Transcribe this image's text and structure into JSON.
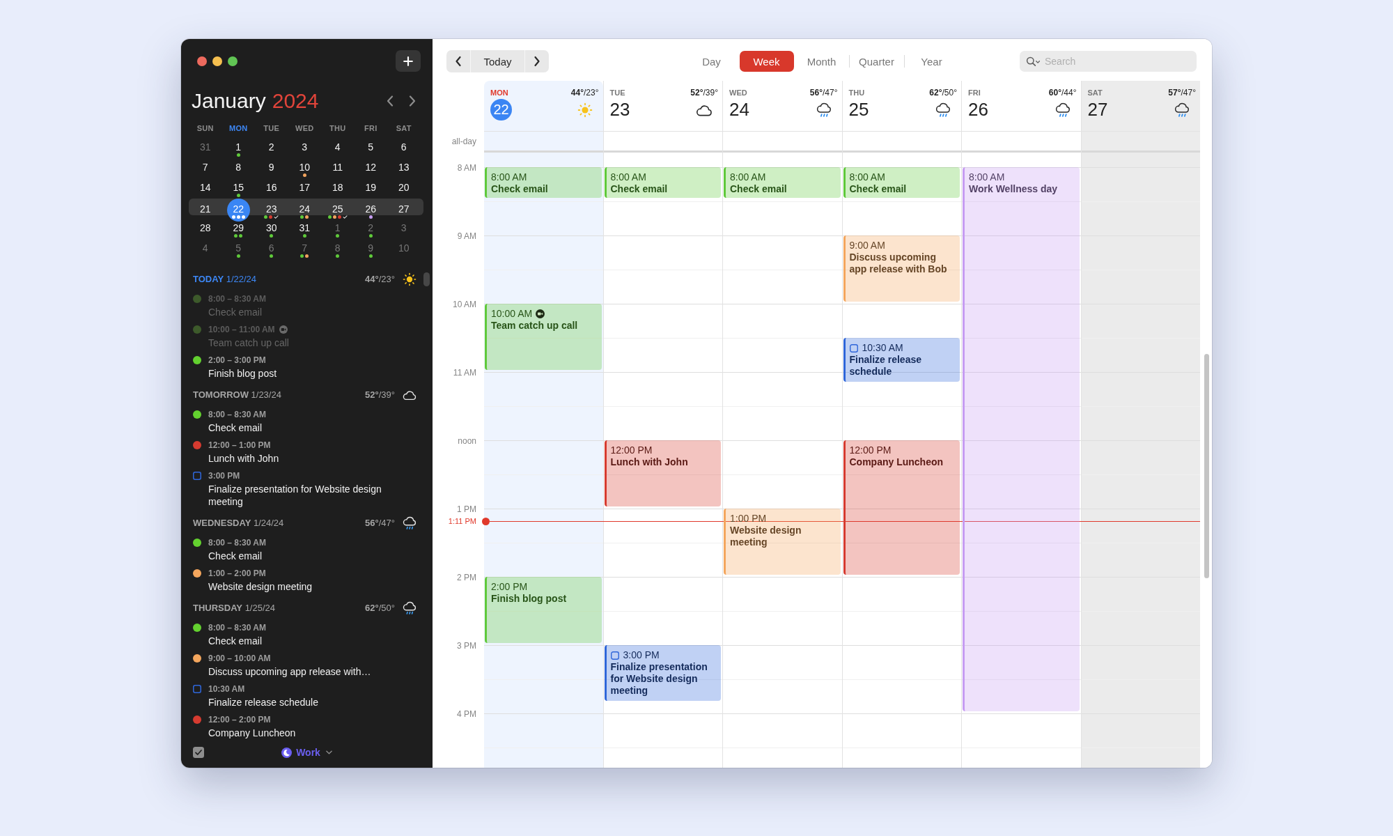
{
  "sidebar": {
    "month": "January",
    "year": "2024",
    "weekdays": [
      {
        "label": "SUN",
        "selected": false
      },
      {
        "label": "MON",
        "selected": true
      },
      {
        "label": "TUE",
        "selected": false
      },
      {
        "label": "WED",
        "selected": false
      },
      {
        "label": "THU",
        "selected": false
      },
      {
        "label": "FRI",
        "selected": false
      },
      {
        "label": "SAT",
        "selected": false
      }
    ],
    "weeks": [
      {
        "days": [
          {
            "label": "31",
            "outside": true,
            "selected": false
          },
          {
            "label": "1",
            "outside": false,
            "selected": false,
            "marks": [
              {
                "kind": "dot",
                "color": "#5fc93a"
              }
            ]
          },
          {
            "label": "2",
            "outside": false,
            "selected": false
          },
          {
            "label": "3",
            "outside": false,
            "selected": false
          },
          {
            "label": "4",
            "outside": false,
            "selected": false
          },
          {
            "label": "5",
            "outside": false,
            "selected": false
          },
          {
            "label": "6",
            "outside": false,
            "selected": false
          }
        ]
      },
      {
        "days": [
          {
            "label": "7",
            "outside": false,
            "selected": false
          },
          {
            "label": "8",
            "outside": false,
            "selected": false
          },
          {
            "label": "9",
            "outside": false,
            "selected": false
          },
          {
            "label": "10",
            "outside": false,
            "selected": false,
            "marks": [
              {
                "kind": "dot",
                "color": "#f0a35e"
              }
            ]
          },
          {
            "label": "11",
            "outside": false,
            "selected": false
          },
          {
            "label": "12",
            "outside": false,
            "selected": false
          },
          {
            "label": "13",
            "outside": false,
            "selected": false
          }
        ]
      },
      {
        "days": [
          {
            "label": "14",
            "outside": false,
            "selected": false
          },
          {
            "label": "15",
            "outside": false,
            "selected": false,
            "marks": [
              {
                "kind": "dot",
                "color": "#5fc93a"
              }
            ]
          },
          {
            "label": "16",
            "outside": false,
            "selected": false
          },
          {
            "label": "17",
            "outside": false,
            "selected": false
          },
          {
            "label": "18",
            "outside": false,
            "selected": false
          },
          {
            "label": "19",
            "outside": false,
            "selected": false
          },
          {
            "label": "20",
            "outside": false,
            "selected": false
          }
        ]
      },
      {
        "days": [
          {
            "label": "21",
            "outside": false,
            "selected": false
          },
          {
            "label": "22",
            "outside": false,
            "selected": true,
            "marks": [
              {
                "kind": "dot",
                "color": "#ffffff"
              },
              {
                "kind": "dot",
                "color": "#ffffff"
              },
              {
                "kind": "dot",
                "color": "#ffffff"
              }
            ]
          },
          {
            "label": "23",
            "outside": false,
            "selected": false,
            "marks": [
              {
                "kind": "dot",
                "color": "#5fc93a"
              },
              {
                "kind": "dot",
                "color": "#d63b30"
              },
              {
                "kind": "check"
              }
            ]
          },
          {
            "label": "24",
            "outside": false,
            "selected": false,
            "marks": [
              {
                "kind": "dot",
                "color": "#5fc93a"
              },
              {
                "kind": "dot",
                "color": "#f0a35e"
              }
            ]
          },
          {
            "label": "25",
            "outside": false,
            "selected": false,
            "marks": [
              {
                "kind": "dot",
                "color": "#5fc93a"
              },
              {
                "kind": "dot",
                "color": "#f0a35e"
              },
              {
                "kind": "dot",
                "color": "#d63b30"
              },
              {
                "kind": "check"
              }
            ]
          },
          {
            "label": "26",
            "outside": false,
            "selected": false,
            "marks": [
              {
                "kind": "dot",
                "color": "#c69cf2"
              }
            ]
          },
          {
            "label": "27",
            "outside": false,
            "selected": false
          }
        ]
      },
      {
        "days": [
          {
            "label": "28",
            "outside": false,
            "selected": false
          },
          {
            "label": "29",
            "outside": false,
            "selected": false,
            "marks": [
              {
                "kind": "dot",
                "color": "#5fc93a"
              },
              {
                "kind": "dot",
                "color": "#5fc93a"
              }
            ]
          },
          {
            "label": "30",
            "outside": false,
            "selected": false,
            "marks": [
              {
                "kind": "dot",
                "color": "#5fc93a"
              }
            ]
          },
          {
            "label": "31",
            "outside": false,
            "selected": false,
            "marks": [
              {
                "kind": "dot",
                "color": "#5fc93a"
              }
            ]
          },
          {
            "label": "1",
            "outside": true,
            "selected": false,
            "marks": [
              {
                "kind": "dot",
                "color": "#5fc93a"
              }
            ]
          },
          {
            "label": "2",
            "outside": true,
            "selected": false,
            "marks": [
              {
                "kind": "dot",
                "color": "#5fc93a"
              }
            ]
          },
          {
            "label": "3",
            "outside": true,
            "selected": false
          }
        ]
      },
      {
        "days": [
          {
            "label": "4",
            "outside": true,
            "selected": false
          },
          {
            "label": "5",
            "outside": true,
            "selected": false,
            "marks": [
              {
                "kind": "dot",
                "color": "#5fc93a"
              }
            ]
          },
          {
            "label": "6",
            "outside": true,
            "selected": false,
            "marks": [
              {
                "kind": "dot",
                "color": "#5fc93a"
              }
            ]
          },
          {
            "label": "7",
            "outside": true,
            "selected": false,
            "marks": [
              {
                "kind": "dot",
                "color": "#5fc93a"
              },
              {
                "kind": "dot",
                "color": "#f0a35e"
              }
            ]
          },
          {
            "label": "8",
            "outside": true,
            "selected": false,
            "marks": [
              {
                "kind": "dot",
                "color": "#5fc93a"
              }
            ]
          },
          {
            "label": "9",
            "outside": true,
            "selected": false,
            "marks": [
              {
                "kind": "dot",
                "color": "#5fc93a"
              }
            ]
          },
          {
            "label": "10",
            "outside": true,
            "selected": false
          }
        ]
      }
    ],
    "agenda": [
      {
        "heading": "**TODAY** 1/22/24",
        "today": true,
        "temperature": "**44°**/23°",
        "weather": {
          "kind": "sun"
        },
        "events": [
          {
            "kind": "event",
            "color": "#3d5a2b",
            "past": true,
            "video": false,
            "time": "8:00 – 8:30 AM",
            "title": "Check email"
          },
          {
            "kind": "event",
            "color": "#3d5a2b",
            "past": true,
            "video": true,
            "time": "10:00 – 11:00 AM",
            "title": "Team catch up call"
          },
          {
            "kind": "event",
            "color": "#63d12f",
            "past": false,
            "video": false,
            "time": "2:00 – 3:00 PM",
            "title": "Finish blog post"
          }
        ]
      },
      {
        "heading": "**TOMORROW** 1/23/24",
        "today": false,
        "temperature": "**52°**/39°",
        "weather": {
          "kind": "cloud"
        },
        "events": [
          {
            "kind": "event",
            "color": "#63d12f",
            "past": false,
            "video": false,
            "time": "8:00 – 8:30 AM",
            "title": "Check email"
          },
          {
            "kind": "event",
            "color": "#d63b30",
            "past": false,
            "video": false,
            "time": "12:00 – 1:00 PM",
            "title": "Lunch with John"
          },
          {
            "kind": "task",
            "color": "#2f66d9",
            "checked": false,
            "past": false,
            "video": false,
            "time": "3:00 PM",
            "title": "Finalize presentation for Website design meeting"
          }
        ]
      },
      {
        "heading": "**WEDNESDAY** 1/24/24",
        "today": false,
        "temperature": "**56°**/47°",
        "weather": {
          "kind": "rain"
        },
        "events": [
          {
            "kind": "event",
            "color": "#63d12f",
            "past": false,
            "video": false,
            "time": "8:00 – 8:30 AM",
            "title": "Check email"
          },
          {
            "kind": "event",
            "color": "#f4a65d",
            "past": false,
            "video": false,
            "time": "1:00 – 2:00 PM",
            "title": "Website design meeting"
          }
        ]
      },
      {
        "heading": "**THURSDAY** 1/25/24",
        "today": false,
        "temperature": "**62°**/50°",
        "weather": {
          "kind": "rain"
        },
        "events": [
          {
            "kind": "event",
            "color": "#63d12f",
            "past": false,
            "video": false,
            "time": "8:00 – 8:30 AM",
            "title": "Check email"
          },
          {
            "kind": "event",
            "color": "#f4a65d",
            "past": false,
            "video": false,
            "time": "9:00 – 10:00 AM",
            "title": "Discuss upcoming app release with…"
          },
          {
            "kind": "task",
            "color": "#2f66d9",
            "checked": false,
            "past": false,
            "video": false,
            "time": "10:30 AM",
            "title": "Finalize release schedule"
          },
          {
            "kind": "event",
            "color": "#d63b30",
            "past": false,
            "video": false,
            "time": "12:00 – 2:00 PM",
            "title": "Company Luncheon"
          }
        ]
      }
    ],
    "footer": {
      "tasks_checked": true,
      "calendar_set": "Work"
    }
  },
  "toolbar": {
    "today_label": "Today",
    "views": [
      {
        "label": "Day",
        "selected": false
      },
      {
        "label": "Week",
        "selected": true
      },
      {
        "label": "Month",
        "selected": false
      },
      {
        "label": "Quarter",
        "selected": false
      },
      {
        "label": "Year",
        "selected": false
      }
    ],
    "search": {
      "placeholder": "Search"
    }
  },
  "week_view": {
    "all_day_label": "all-day",
    "hours": [
      "8 AM",
      "9 AM",
      "10 AM",
      "11 AM",
      "noon",
      "1 PM",
      "2 PM",
      "3 PM",
      "4 PM"
    ],
    "now": {
      "label": "1:11 PM"
    },
    "days": [
      {
        "weekday": "MON",
        "date": "22",
        "selected": true,
        "weekend": false,
        "temperature": "**44°**/23°",
        "weather": {
          "kind": "sun"
        },
        "events": [
          {
            "kind": "event",
            "time": "8:00 AM",
            "title": "Check email",
            "color": "#5fc93a",
            "video": false
          },
          {
            "kind": "event",
            "time": "10:00 AM",
            "title": "Team catch up call",
            "color": "#5fc93a",
            "video": true
          },
          {
            "kind": "event",
            "time": "2:00 PM",
            "title": "Finish blog post",
            "color": "#5fc93a",
            "video": false
          }
        ]
      },
      {
        "weekday": "TUE",
        "date": "23",
        "selected": false,
        "weekend": false,
        "temperature": "**52°**/39°",
        "weather": {
          "kind": "cloud"
        },
        "events": [
          {
            "kind": "event",
            "time": "8:00 AM",
            "title": "Check email",
            "color": "#5fc93a",
            "video": false
          },
          {
            "kind": "event",
            "time": "12:00 PM",
            "title": "Lunch with John",
            "color": "#d63b30",
            "video": false
          },
          {
            "kind": "task",
            "time": "3:00 PM",
            "title": "Finalize presentation for Website design meeting",
            "color": "#2f66d9",
            "checked": false,
            "video": false
          }
        ]
      },
      {
        "weekday": "WED",
        "date": "24",
        "selected": false,
        "weekend": false,
        "temperature": "**56°**/47°",
        "weather": {
          "kind": "rain"
        },
        "events": [
          {
            "kind": "event",
            "time": "8:00 AM",
            "title": "Check email",
            "color": "#5fc93a",
            "video": false
          },
          {
            "kind": "event",
            "time": "1:00 PM",
            "title": "Website design meeting",
            "color": "#f4a65d",
            "video": false
          }
        ]
      },
      {
        "weekday": "THU",
        "date": "25",
        "selected": false,
        "weekend": false,
        "temperature": "**62°**/50°",
        "weather": {
          "kind": "rain"
        },
        "events": [
          {
            "kind": "event",
            "time": "8:00 AM",
            "title": "Check email",
            "color": "#5fc93a",
            "video": false
          },
          {
            "kind": "event",
            "time": "9:00 AM",
            "title": "Discuss upcoming app release with Bob",
            "color": "#f4a65d",
            "video": false
          },
          {
            "kind": "task",
            "time": "10:30 AM",
            "title": "Finalize release schedule",
            "color": "#2f66d9",
            "checked": false,
            "video": false
          },
          {
            "kind": "event",
            "time": "12:00 PM",
            "title": "Company Luncheon",
            "color": "#d63b30",
            "video": false
          }
        ]
      },
      {
        "weekday": "FRI",
        "date": "26",
        "selected": false,
        "weekend": false,
        "temperature": "**60°**/44°",
        "weather": {
          "kind": "rain"
        },
        "events": [
          {
            "kind": "event",
            "time": "8:00 AM",
            "title": "Work Wellness day",
            "color": "#c69cf2",
            "video": false
          }
        ]
      },
      {
        "weekday": "SAT",
        "date": "27",
        "selected": false,
        "weekend": true,
        "temperature": "**57°**/47°",
        "weather": {
          "kind": "rain"
        }
      }
    ]
  }
}
